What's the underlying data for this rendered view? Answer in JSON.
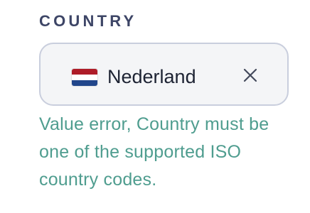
{
  "field": {
    "label": "COUNTRY",
    "selected": {
      "name": "Nederland",
      "flag_icon": "netherlands-flag-icon",
      "flag_colors": [
        "#ae1c28",
        "#ffffff",
        "#21468b"
      ]
    },
    "clear_icon": "close-icon",
    "error_message": "Value error, Country must be one of the supported ISO country codes."
  },
  "colors": {
    "label": "#3d4566",
    "field_border": "#c9cedd",
    "field_background": "#f4f5f7",
    "value_text": "#1d2333",
    "error_text": "#4f9d8f"
  }
}
